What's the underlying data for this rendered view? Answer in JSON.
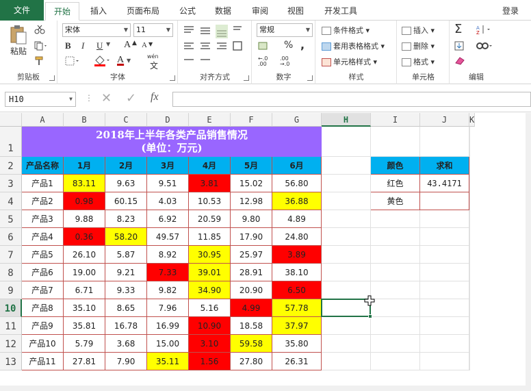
{
  "ribbon_tabs": [
    "文件",
    "开始",
    "插入",
    "页面布局",
    "公式",
    "数据",
    "审阅",
    "视图",
    "开发工具"
  ],
  "login": "登录",
  "clipboard": {
    "paste": "粘贴",
    "label": "剪贴板"
  },
  "font": {
    "name": "宋体",
    "size": "11",
    "label": "字体",
    "bold": "B",
    "italic": "I",
    "underline": "U",
    "font_color_letter": "A",
    "increase": "A",
    "decrease": "A",
    "wen": "wén",
    "wen_char": "文"
  },
  "alignment": {
    "label": "对齐方式"
  },
  "number": {
    "format": "常规",
    "label": "数字",
    "percent": "%",
    "comma": ","
  },
  "styles": {
    "conditional": "条件格式",
    "table": "套用表格格式",
    "cell": "单元格样式",
    "label": "样式"
  },
  "cells": {
    "insert": "插入",
    "delete": "删除",
    "format": "格式",
    "label": "单元格"
  },
  "editing": {
    "sigma": "Σ",
    "label": "编辑"
  },
  "formula_bar": {
    "name_box": "H10",
    "fx": "fx",
    "formula": ""
  },
  "colors": {
    "title_bg": "#9966ff",
    "header_bg": "#00b0f0",
    "yellow": "#ffff00",
    "red": "#ff0000",
    "accent": "#217346",
    "border": "#c0504d"
  },
  "columns": [
    "A",
    "B",
    "C",
    "D",
    "E",
    "F",
    "G",
    "H",
    "I",
    "J",
    "K"
  ],
  "rows": [
    "1",
    "2",
    "3",
    "4",
    "5",
    "6",
    "7",
    "8",
    "9",
    "10",
    "11",
    "12",
    "13"
  ],
  "selected_cell": {
    "col": "H",
    "row": "10"
  },
  "table": {
    "title_line1": "2018年上半年各类产品销售情况",
    "title_line2": "(单位：万元)",
    "headers": [
      "产品名称",
      "1月",
      "2月",
      "3月",
      "4月",
      "5月",
      "6月"
    ],
    "rows": [
      {
        "name": "产品1",
        "values": [
          "83.11",
          "9.63",
          "9.51",
          "3.81",
          "15.02",
          "56.80"
        ],
        "fills": [
          "yellow",
          "",
          "",
          "red",
          "",
          ""
        ]
      },
      {
        "name": "产品2",
        "values": [
          "0.98",
          "60.15",
          "4.03",
          "10.53",
          "12.98",
          "36.88"
        ],
        "fills": [
          "red",
          "",
          "",
          "",
          "",
          "yellow"
        ]
      },
      {
        "name": "产品3",
        "values": [
          "9.88",
          "8.23",
          "6.92",
          "20.59",
          "9.80",
          "4.89"
        ],
        "fills": [
          "",
          "",
          "",
          "",
          "",
          ""
        ]
      },
      {
        "name": "产品4",
        "values": [
          "0.36",
          "58.20",
          "49.57",
          "11.85",
          "17.90",
          "24.80"
        ],
        "fills": [
          "red",
          "yellow",
          "",
          "",
          "",
          ""
        ]
      },
      {
        "name": "产品5",
        "values": [
          "26.10",
          "5.87",
          "8.92",
          "30.95",
          "25.97",
          "3.89"
        ],
        "fills": [
          "",
          "",
          "",
          "yellow",
          "",
          "red"
        ]
      },
      {
        "name": "产品6",
        "values": [
          "19.00",
          "9.21",
          "7.33",
          "39.01",
          "28.91",
          "38.10"
        ],
        "fills": [
          "",
          "",
          "red",
          "yellow",
          "",
          ""
        ]
      },
      {
        "name": "产品7",
        "values": [
          "6.71",
          "9.33",
          "9.82",
          "34.90",
          "20.90",
          "6.50"
        ],
        "fills": [
          "",
          "",
          "",
          "yellow",
          "",
          "red"
        ]
      },
      {
        "name": "产品8",
        "values": [
          "35.10",
          "8.65",
          "7.96",
          "5.16",
          "4.99",
          "57.78"
        ],
        "fills": [
          "",
          "",
          "",
          "",
          "red",
          "yellow"
        ]
      },
      {
        "name": "产品9",
        "values": [
          "35.81",
          "16.78",
          "16.99",
          "10.90",
          "18.58",
          "37.97"
        ],
        "fills": [
          "",
          "",
          "",
          "red",
          "",
          "yellow"
        ]
      },
      {
        "name": "产品10",
        "values": [
          "5.79",
          "3.68",
          "15.00",
          "3.10",
          "59.58",
          "35.80"
        ],
        "fills": [
          "",
          "",
          "",
          "red",
          "yellow",
          ""
        ]
      },
      {
        "name": "产品11",
        "values": [
          "27.81",
          "7.90",
          "35.11",
          "1.56",
          "27.80",
          "26.31"
        ],
        "fills": [
          "",
          "",
          "yellow",
          "red",
          "",
          ""
        ]
      }
    ]
  },
  "summary": {
    "headers": [
      "颜色",
      "求和"
    ],
    "rows": [
      {
        "color": "红色",
        "sum": "43.4171"
      },
      {
        "color": "黄色",
        "sum": ""
      }
    ]
  }
}
